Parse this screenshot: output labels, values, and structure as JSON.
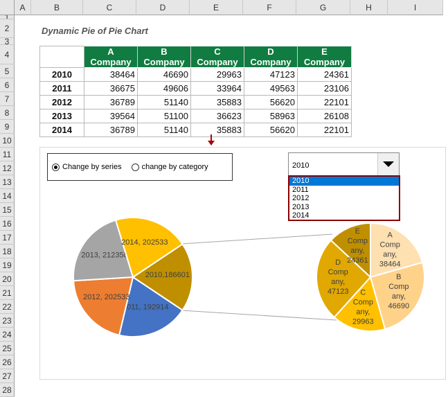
{
  "columns": [
    "A",
    "B",
    "C",
    "D",
    "E",
    "F",
    "G",
    "H",
    "I"
  ],
  "rows": [
    "1",
    "2",
    "3",
    "4",
    "5",
    "6",
    "7",
    "8",
    "9",
    "10",
    "11",
    "12",
    "13",
    "14",
    "15",
    "16",
    "17",
    "18",
    "19",
    "20",
    "21",
    "22",
    "23",
    "24",
    "25",
    "26",
    "27",
    "28"
  ],
  "title": "Dynamic Pie of Pie Chart",
  "table": {
    "headers": [
      "A Company",
      "B Company",
      "C Company",
      "D Company",
      "E Company"
    ],
    "rows": [
      {
        "year": "2010",
        "values": [
          "38464",
          "46690",
          "29963",
          "47123",
          "24361"
        ]
      },
      {
        "year": "2011",
        "values": [
          "36675",
          "49606",
          "33964",
          "49563",
          "23106"
        ]
      },
      {
        "year": "2012",
        "values": [
          "36789",
          "51140",
          "35883",
          "56620",
          "22101"
        ]
      },
      {
        "year": "2013",
        "values": [
          "39564",
          "51100",
          "36623",
          "58963",
          "26108"
        ]
      },
      {
        "year": "2014",
        "values": [
          "36789",
          "51140",
          "35883",
          "56620",
          "22101"
        ]
      }
    ]
  },
  "controls": {
    "radio_series": "Change by series",
    "radio_category": "change by category",
    "selected_radio": "series",
    "dropdown_value": "2010",
    "dropdown_options": [
      "2010",
      "2011",
      "2012",
      "2013",
      "2014"
    ],
    "selected_option": "2010"
  },
  "chart_data": {
    "type": "pie-of-pie",
    "main": {
      "slices": [
        {
          "label": "2010,186601",
          "value": 186601,
          "color": "#bf8f00"
        },
        {
          "label": "2011, 192914",
          "value": 192914,
          "color": "#4472c4"
        },
        {
          "label": "2012, 202533",
          "value": 202533,
          "color": "#ed7d31"
        },
        {
          "label": "2013, 212358",
          "value": 212358,
          "color": "#a5a5a5"
        },
        {
          "label": "2014, 202533",
          "value": 202533,
          "color": "#ffc000"
        }
      ]
    },
    "secondary": {
      "slices": [
        {
          "label": "A Company, 38464",
          "value": 38464,
          "color": "#ffe0b0"
        },
        {
          "label": "B Company, 46690",
          "value": 46690,
          "color": "#ffd28a"
        },
        {
          "label": "C Company, 29963",
          "value": 29963,
          "color": "#ffc000"
        },
        {
          "label": "D Company, 47123",
          "value": 47123,
          "color": "#e0a800"
        },
        {
          "label": "E Company, 24361",
          "value": 24361,
          "color": "#bf8f00"
        }
      ]
    }
  }
}
